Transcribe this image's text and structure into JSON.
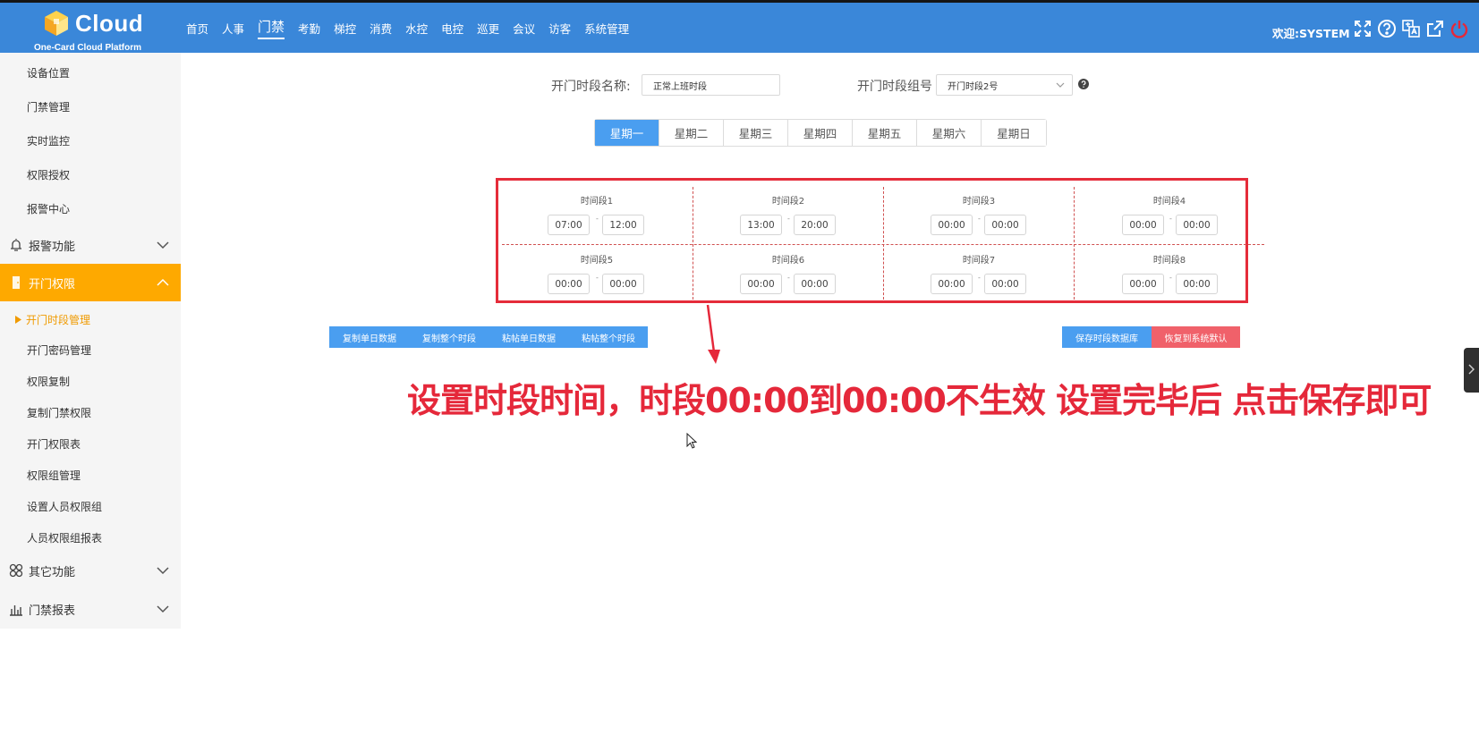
{
  "brand": {
    "name": "Cloud",
    "subtitle": "One-Card Cloud Platform"
  },
  "nav": {
    "items": [
      "首页",
      "人事",
      "门禁",
      "考勤",
      "梯控",
      "消费",
      "水控",
      "电控",
      "巡更",
      "会议",
      "访客",
      "系统管理"
    ],
    "active_index": 2
  },
  "header": {
    "welcome": "欢迎:SYSTEM"
  },
  "sidebar": {
    "top_items": [
      "设备位置",
      "门禁管理",
      "实时监控",
      "权限授权",
      "报警中心"
    ],
    "group_alarm": "报警功能",
    "group_door_permission": "开门权限",
    "current_item": "开门时段管理",
    "sub_items": [
      "开门密码管理",
      "权限复制",
      "复制门禁权限",
      "开门权限表",
      "权限组管理",
      "设置人员权限组",
      "人员权限组报表"
    ],
    "group_other": "其它功能",
    "group_report": "门禁报表"
  },
  "form": {
    "name_label": "开门时段名称:",
    "name_value": "正常上班时段",
    "group_label": "开门时段组号",
    "group_value": "开门时段2号"
  },
  "weekdays": {
    "items": [
      "星期一",
      "星期二",
      "星期三",
      "星期四",
      "星期五",
      "星期六",
      "星期日"
    ],
    "active_index": 0
  },
  "slots": [
    {
      "label": "时间段1",
      "start": "07:00",
      "end": "12:00"
    },
    {
      "label": "时间段2",
      "start": "13:00",
      "end": "20:00"
    },
    {
      "label": "时间段3",
      "start": "00:00",
      "end": "00:00"
    },
    {
      "label": "时间段4",
      "start": "00:00",
      "end": "00:00"
    },
    {
      "label": "时间段5",
      "start": "00:00",
      "end": "00:00"
    },
    {
      "label": "时间段6",
      "start": "00:00",
      "end": "00:00"
    },
    {
      "label": "时间段7",
      "start": "00:00",
      "end": "00:00"
    },
    {
      "label": "时间段8",
      "start": "00:00",
      "end": "00:00"
    }
  ],
  "range_separator": "-",
  "actions_left": [
    "复制单日数据",
    "复制整个时段",
    "粘帖单日数据",
    "粘帖整个时段"
  ],
  "actions_right": {
    "save": "保存时段数据库",
    "restore": "恢复到系统默认"
  },
  "annotation": "设置时段时间，时段00:00到00:00不生效 设置完毕后 点击保存即可",
  "colors": {
    "header": "#3a87d9",
    "active_group": "#fea900",
    "primary": "#4a9ef0",
    "danger": "#f0616a",
    "annotation": "#e5283a"
  }
}
